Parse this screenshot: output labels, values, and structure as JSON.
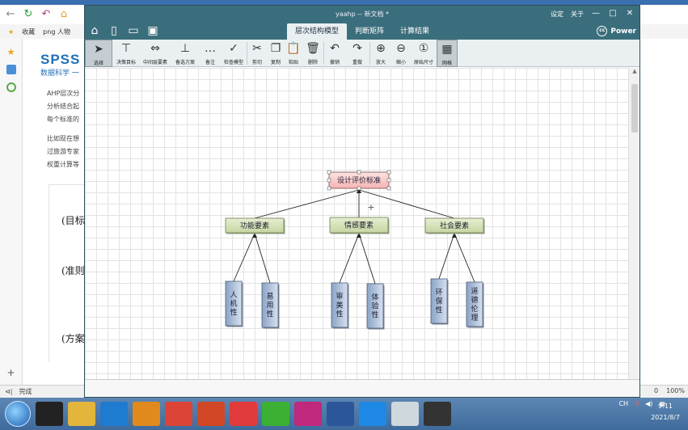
{
  "browser": {
    "bookmarks": [
      "收藏",
      "png 人物"
    ],
    "spss_logo": "SPSS",
    "spss_sub": "数据科学 一",
    "paragraphs": [
      "AHP层次分",
      "分析结合起",
      "每个标准的",
      "比如现在想",
      "过旅游专家",
      "权重计算等"
    ],
    "levels": [
      "(目标",
      "(准则",
      "(方案"
    ],
    "status_left": "完成",
    "status_right": [
      "0",
      "100%"
    ]
  },
  "window": {
    "title": "yaahp -- 新文档 *",
    "title_right": [
      "设定",
      "关于"
    ],
    "controls": [
      "—",
      "□",
      "✕"
    ]
  },
  "ribbon": {
    "tabs": [
      "层次结构模型",
      "判断矩阵",
      "计算结果"
    ],
    "active_tab": 0,
    "power": "Power",
    "power_icon": "cc"
  },
  "toolbar": {
    "tools": [
      {
        "label": "选择",
        "icon": "cursor-icon",
        "glyph": "➤"
      },
      {
        "label": "决策目标",
        "icon": "goal-icon",
        "glyph": "⊤"
      },
      {
        "label": "中间层要素",
        "icon": "middle-icon",
        "glyph": "⇔"
      },
      {
        "label": "备选方案",
        "icon": "alternative-icon",
        "glyph": "⊥"
      },
      {
        "label": "备注",
        "icon": "note-icon",
        "glyph": "…"
      },
      {
        "label": "检查模型",
        "icon": "check-icon",
        "glyph": "✓"
      },
      {
        "label": "剪切",
        "icon": "cut-icon",
        "glyph": "✂"
      },
      {
        "label": "复制",
        "icon": "copy-icon",
        "glyph": "❐"
      },
      {
        "label": "粘贴",
        "icon": "paste-icon",
        "glyph": "📋"
      },
      {
        "label": "删除",
        "icon": "delete-icon",
        "glyph": "🗑"
      },
      {
        "label": "撤销",
        "icon": "undo-icon",
        "glyph": "↶"
      },
      {
        "label": "重做",
        "icon": "redo-icon",
        "glyph": "↷"
      },
      {
        "label": "放大",
        "icon": "zoom-in-icon",
        "glyph": "⊕"
      },
      {
        "label": "缩小",
        "icon": "zoom-out-icon",
        "glyph": "⊖"
      },
      {
        "label": "原始尺寸",
        "icon": "actual-size-icon",
        "glyph": "①"
      },
      {
        "label": "网格",
        "icon": "grid-icon",
        "glyph": "▦"
      }
    ]
  },
  "diagram": {
    "goal": "设计评价标准",
    "criteria": [
      "功能要素",
      "情感要素",
      "社会要素"
    ],
    "alternatives": [
      [
        "人机性",
        "易用性"
      ],
      [
        "审美性",
        "体验性"
      ],
      [
        "环保性",
        "道德伦理"
      ]
    ],
    "colors": {
      "goal_fill": "#f5b3b3",
      "criteria_fill": "#c6d5a2",
      "alt_fill": "#a9bcd8",
      "line": "#222222"
    }
  },
  "taskbar": {
    "apps": [
      "qq-icon",
      "files-icon",
      "sogou-icon",
      "search-icon",
      "chrome-icon",
      "powerpoint-icon",
      "office-icon",
      "wechat-icon",
      "pointer-icon",
      "word-icon",
      "meeting-icon",
      "ahp-icon",
      "obs-icon"
    ],
    "tray_text": "CH",
    "time": "9:11",
    "date": "2021/8/7"
  }
}
